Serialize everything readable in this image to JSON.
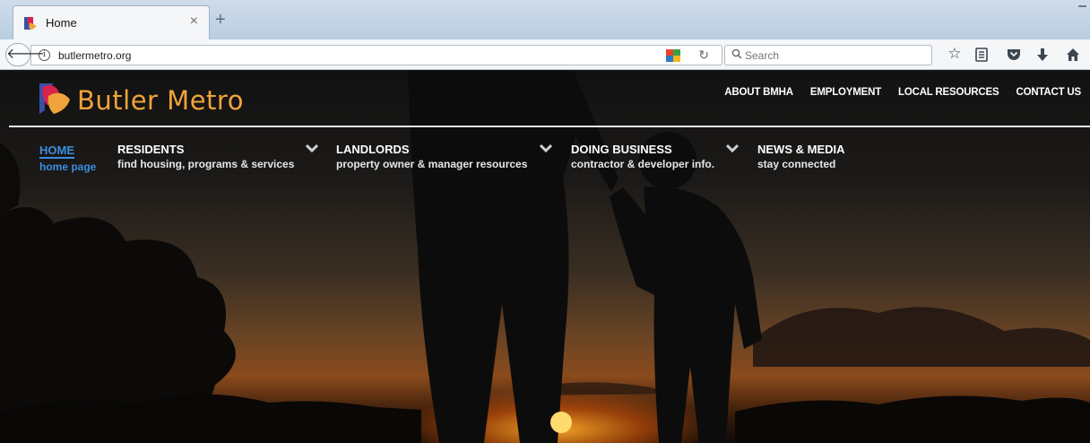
{
  "browser": {
    "tab_title": "Home",
    "tab_close": "×",
    "new_tab": "+",
    "url": "butlermetro.org",
    "search_placeholder": "Search",
    "minimize": "–"
  },
  "site": {
    "logo_text": "Butler Metro",
    "brand_color": "#f0a33a",
    "accent_color": "#3a8ee0",
    "top_links": [
      "ABOUT BMHA",
      "EMPLOYMENT",
      "LOCAL RESOURCES",
      "CONTACT US"
    ],
    "menu": [
      {
        "title": "HOME",
        "sub": "home page",
        "active": true
      },
      {
        "title": "RESIDENTS",
        "sub": "find housing, programs & services",
        "dropdown": true
      },
      {
        "title": "LANDLORDS",
        "sub": "property owner & manager resources",
        "dropdown": true
      },
      {
        "title": "DOING BUSINESS",
        "sub": "contractor & developer info.",
        "dropdown": true
      },
      {
        "title": "NEWS & MEDIA",
        "sub": "stay connected"
      }
    ]
  },
  "icons": {
    "back": "back-arrow-icon",
    "info": "info-icon",
    "reload": "reload-icon",
    "search": "search-icon",
    "toolbar": [
      "bookmark-star-icon",
      "reading-list-icon",
      "pocket-icon",
      "download-icon",
      "home-icon"
    ]
  }
}
